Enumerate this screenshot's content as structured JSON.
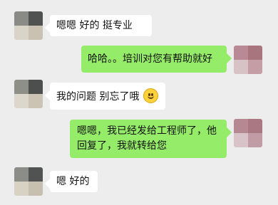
{
  "chat": {
    "messages": [
      {
        "side": "in",
        "text": "嗯嗯 好的  挺专业"
      },
      {
        "side": "out",
        "text": "哈哈。。培训对您有帮助就好"
      },
      {
        "side": "in",
        "text": "我的问题 别忘了哦",
        "emoji": "smile-emoji"
      },
      {
        "side": "out",
        "line1": "嗯嗯，我已经发给工程师了，他",
        "line2": "回复了，我就转给您"
      },
      {
        "side": "in",
        "text": "嗯 好的"
      }
    ]
  },
  "colors": {
    "background": "#ededed",
    "incoming_bubble": "#ffffff",
    "outgoing_bubble": "#95ec69",
    "text": "#111111"
  },
  "icons": {
    "incoming_avatar": "blurred-avatar",
    "outgoing_avatar": "blurred-avatar",
    "emoji": "smile-emoji"
  }
}
